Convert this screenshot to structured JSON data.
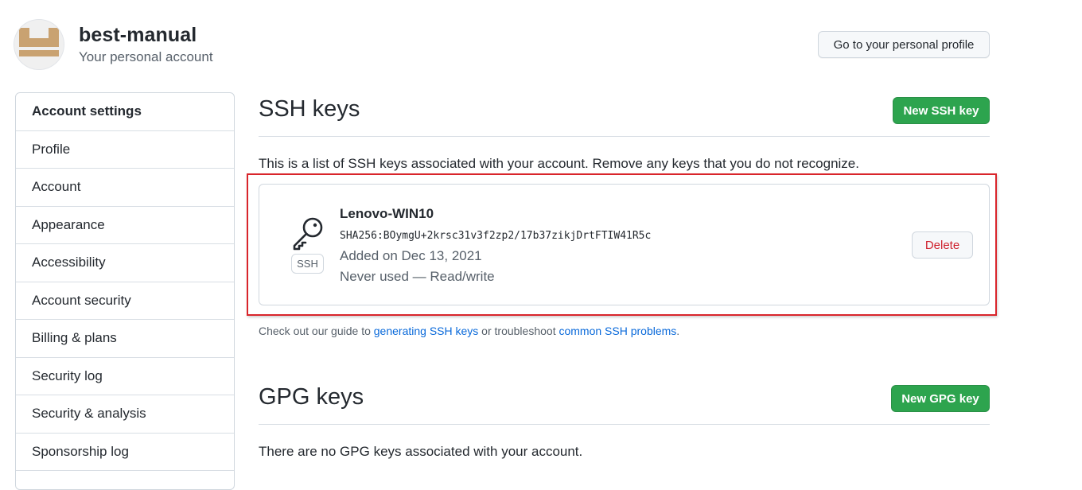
{
  "header": {
    "account_name": "best-manual",
    "account_subtitle": "Your personal account",
    "profile_button": "Go to your personal profile"
  },
  "sidebar": {
    "items": [
      {
        "label": "Account settings"
      },
      {
        "label": "Profile"
      },
      {
        "label": "Account"
      },
      {
        "label": "Appearance"
      },
      {
        "label": "Accessibility"
      },
      {
        "label": "Account security"
      },
      {
        "label": "Billing & plans"
      },
      {
        "label": "Security log"
      },
      {
        "label": "Security & analysis"
      },
      {
        "label": "Sponsorship log"
      }
    ]
  },
  "ssh": {
    "title": "SSH keys",
    "new_button": "New SSH key",
    "description": "This is a list of SSH keys associated with your account. Remove any keys that you do not recognize.",
    "key": {
      "name": "Lenovo-WIN10",
      "fingerprint": "SHA256:BOymgU+2krsc31v3f2zp2/17b37zikjDrtFTIW41R5c",
      "added": "Added on Dec 13, 2021",
      "usage": "Never used — Read/write",
      "type_label": "SSH",
      "delete_button": "Delete",
      "icon": "key-icon"
    },
    "guide": {
      "prefix": "Check out our guide to ",
      "link1": "generating SSH keys",
      "middle": " or troubleshoot ",
      "link2": "common SSH problems",
      "suffix": "."
    }
  },
  "gpg": {
    "title": "GPG keys",
    "new_button": "New GPG key",
    "empty_text": "There are no GPG keys associated with your account."
  },
  "colors": {
    "primary_green": "#2da44e",
    "link_blue": "#0969da",
    "danger_red": "#cf222e",
    "highlight_red": "#d9252b",
    "avatar_tan": "#c9a271"
  }
}
